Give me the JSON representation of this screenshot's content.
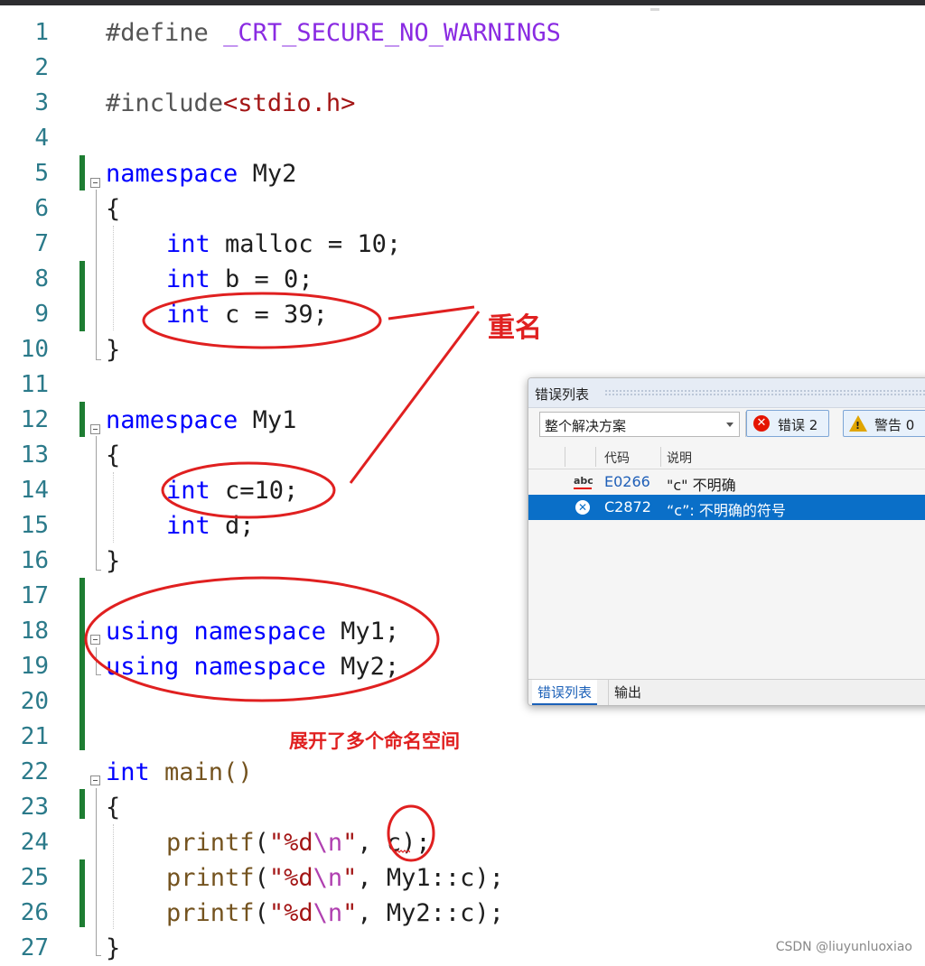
{
  "editor": {
    "lines": [
      {
        "num": "1"
      },
      {
        "num": "2"
      },
      {
        "num": "3"
      },
      {
        "num": "4"
      },
      {
        "num": "5"
      },
      {
        "num": "6"
      },
      {
        "num": "7"
      },
      {
        "num": "8"
      },
      {
        "num": "9"
      },
      {
        "num": "10"
      },
      {
        "num": "11"
      },
      {
        "num": "12"
      },
      {
        "num": "13"
      },
      {
        "num": "14"
      },
      {
        "num": "15"
      },
      {
        "num": "16"
      },
      {
        "num": "17"
      },
      {
        "num": "18"
      },
      {
        "num": "19"
      },
      {
        "num": "20"
      },
      {
        "num": "21"
      },
      {
        "num": "22"
      },
      {
        "num": "23"
      },
      {
        "num": "24"
      },
      {
        "num": "25"
      },
      {
        "num": "26"
      },
      {
        "num": "27"
      }
    ],
    "code": {
      "define_kw": "#define",
      "define_macro": "_CRT_SECURE_NO_WARNINGS",
      "include_kw": "#include",
      "include_file": "<stdio.h>",
      "namespace_kw": "namespace",
      "ns_my2": "My2",
      "ns_my1": "My1",
      "brace_open": "{",
      "brace_close": "}",
      "int_kw": "int",
      "malloc_decl": " malloc = 10;",
      "b_decl": " b = 0;",
      "c_decl_my2": " c = 39;",
      "c_decl_my1": " c=10;",
      "d_decl": " d;",
      "using_kw": "using",
      "using_my1_tail": " My1;",
      "using_my2_tail": " My2;",
      "main_sig": " main()",
      "printf_fn": "printf",
      "paren_open": "(",
      "str_open": "\"%d",
      "str_escape": "\\n",
      "str_close": "\"",
      "arg_c": ", c);",
      "arg_my1c": ", My1::c);",
      "arg_my2c": ", My2::c);"
    }
  },
  "annotations": {
    "duplicate_name": "重名",
    "expanded_namespaces": "展开了多个命名空间",
    "ink_color": "#e02020"
  },
  "error_list": {
    "title": "错误列表",
    "scope": "整个解决方案",
    "errors_button": "错误 2",
    "warnings_button": "警告 0",
    "columns": {
      "code": "代码",
      "description": "说明"
    },
    "rows": [
      {
        "icon": "spelling-error-icon",
        "code": "E0266",
        "description": "\"c\" 不明确"
      },
      {
        "icon": "error-circle-icon",
        "code": "C2872",
        "description": "“c”: 不明确的符号",
        "selected": true
      }
    ],
    "tabs": {
      "active": "错误列表",
      "other": "输出"
    },
    "selection_color": "#0a6fc8"
  },
  "watermark": "CSDN @liuyunluoxiao"
}
